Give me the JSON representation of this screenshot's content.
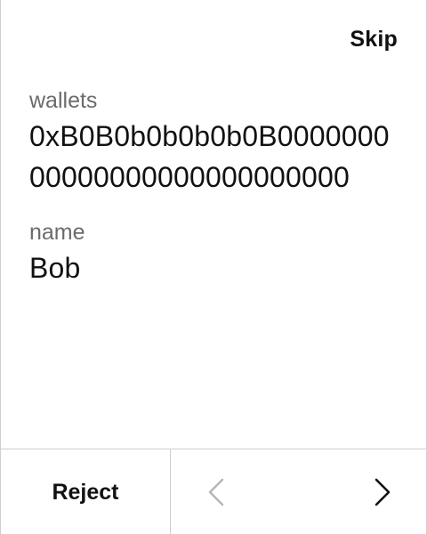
{
  "header": {
    "skip_label": "Skip"
  },
  "fields": [
    {
      "label": "wallets",
      "value": "0xB0B0b0b0b0b0B000000000000000000000000000"
    },
    {
      "label": "name",
      "value": "Bob"
    }
  ],
  "footer": {
    "reject_label": "Reject",
    "prev_icon": "chevron-left-icon",
    "next_icon": "chevron-right-icon",
    "prev_color": "#b5b5b5",
    "next_color": "#111111"
  }
}
